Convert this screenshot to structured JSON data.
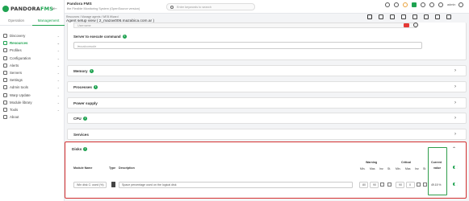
{
  "brand": {
    "name_part1": "PANDORA",
    "name_part2": "FMS"
  },
  "sidebar": {
    "tabs": [
      {
        "label": "Operation"
      },
      {
        "label": "Management"
      }
    ],
    "items": [
      {
        "label": "Discovery"
      },
      {
        "label": "Resources"
      },
      {
        "label": "Profiles"
      },
      {
        "label": "Configuration"
      },
      {
        "label": "Alerts"
      },
      {
        "label": "Servers"
      },
      {
        "label": "Settings"
      },
      {
        "label": "Admin tools"
      },
      {
        "label": "Warp Update"
      },
      {
        "label": "Module library"
      },
      {
        "label": "Tools"
      },
      {
        "label": "About"
      }
    ]
  },
  "header": {
    "app_title": "Pandora FMS",
    "app_subtitle": "the Flexible Monitoring System (OpenSource version)",
    "search_placeholder": "Enter keywords to search",
    "user": "admin"
  },
  "page": {
    "breadcrumb": "Resources / Manage agents / WEB Wizard",
    "title": "Agent setup view ( 2_mazav006.mazabica.com.ar )"
  },
  "top_section": {
    "field_placeholder": "Username",
    "exec_label": "Server to execute command",
    "exec_value": "Localconsole"
  },
  "sections": [
    {
      "label": "Memory",
      "has_info": true
    },
    {
      "label": "Processes",
      "has_info": true
    },
    {
      "label": "Power supply",
      "has_info": false
    },
    {
      "label": "CPU",
      "has_info": true
    },
    {
      "label": "Services",
      "has_info": false
    }
  ],
  "disks": {
    "label": "Disks",
    "headers": {
      "module_name": "Module Name",
      "type": "Type",
      "description": "Description",
      "warning": "Warning",
      "critical": "Critical",
      "min": "Min.",
      "max": "Max.",
      "inv": "Inv.",
      "str": "St.",
      "current": "Current",
      "value": "value"
    },
    "row": {
      "module_name": "Win disk C: used (%)",
      "description": "Space percentage used on the logical disk",
      "warn_min": "80",
      "warn_max": "90",
      "crit_min": "90",
      "crit_max": "0",
      "current_value": "49.15 %"
    }
  },
  "colors": {
    "accent": "#1fa351",
    "highlight": "#d32f2f"
  }
}
